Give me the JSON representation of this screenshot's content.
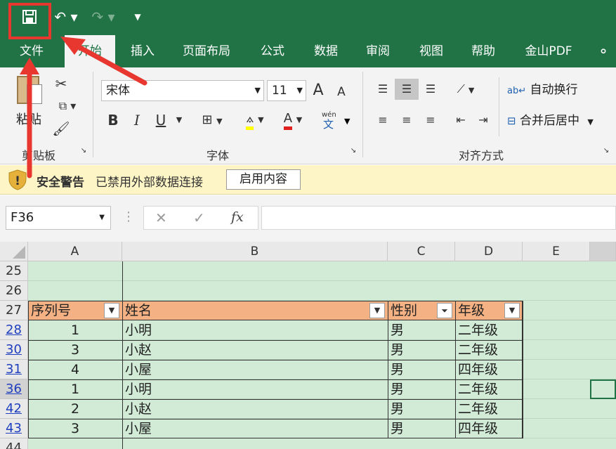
{
  "quick_access": {
    "save_icon": "save-icon",
    "undo_icon": "undo-icon",
    "redo_icon": "redo-icon",
    "customize_icon": "customize-icon"
  },
  "tabs": [
    {
      "label": "文件"
    },
    {
      "label": "开始"
    },
    {
      "label": "插入"
    },
    {
      "label": "页面布局"
    },
    {
      "label": "公式"
    },
    {
      "label": "数据"
    },
    {
      "label": "审阅"
    },
    {
      "label": "视图"
    },
    {
      "label": "帮助"
    },
    {
      "label": "金山PDF"
    }
  ],
  "ribbon": {
    "clipboard": {
      "paste_label": "粘贴",
      "group_label": "剪贴板"
    },
    "font": {
      "font_name": "宋体",
      "font_size": "11",
      "group_label": "字体",
      "bold": "B",
      "italic": "I",
      "underline": "U",
      "grow": "A",
      "shrink": "A",
      "phonetic_top": "wén",
      "phonetic_bottom": "文"
    },
    "alignment": {
      "wrap_label": "自动换行",
      "merge_label": "合并后居中",
      "group_label": "对齐方式"
    }
  },
  "security": {
    "title": "安全警告",
    "message": "已禁用外部数据连接",
    "button": "启用内容"
  },
  "formula_bar": {
    "name_box": "F36",
    "fx": "fx",
    "value": ""
  },
  "sheet": {
    "columns": [
      "A",
      "B",
      "C",
      "D",
      "E"
    ],
    "header_row": {
      "row": "27",
      "cells": [
        "序列号",
        "姓名",
        "性别",
        "年级"
      ]
    },
    "empty_rows": [
      "25",
      "26"
    ],
    "rows": [
      {
        "row": "28",
        "cells": [
          "1",
          "小明",
          "男",
          "二年级"
        ]
      },
      {
        "row": "30",
        "cells": [
          "3",
          "小赵",
          "男",
          "二年级"
        ]
      },
      {
        "row": "31",
        "cells": [
          "4",
          "小屋",
          "男",
          "四年级"
        ]
      },
      {
        "row": "36",
        "cells": [
          "1",
          "小明",
          "男",
          "二年级"
        ]
      },
      {
        "row": "42",
        "cells": [
          "2",
          "小赵",
          "男",
          "二年级"
        ]
      },
      {
        "row": "43",
        "cells": [
          "3",
          "小屋",
          "男",
          "四年级"
        ]
      }
    ],
    "last_row": "44"
  },
  "colors": {
    "accent": "#217346",
    "header_fill": "#f4b183",
    "band_fill": "#d1ebd6",
    "annotation": "#e8372f"
  }
}
